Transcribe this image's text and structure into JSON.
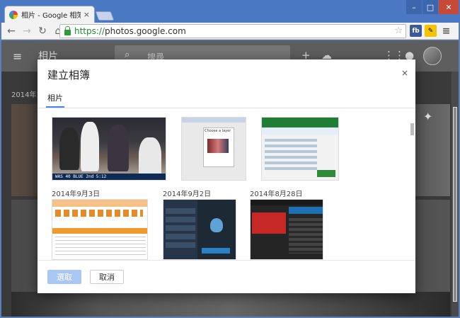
{
  "browser": {
    "tab_title": "相片 - Google 相簿",
    "tab_close": "×",
    "url_scheme": "https://",
    "url_host": "photos.google.com",
    "toolbar_icons": [
      "back-icon",
      "forward-icon",
      "reload-icon",
      "home-icon"
    ],
    "extensions": [
      {
        "name": "facebook-extension-icon",
        "label": "fb"
      },
      {
        "name": "evernote-extension-icon",
        "label": "✎"
      }
    ]
  },
  "app": {
    "title": "相片",
    "search_placeholder": "搜尋",
    "bg_date": "2014年1"
  },
  "dialog": {
    "title": "建立相簿",
    "close": "×",
    "tab": "相片",
    "groups": [
      {
        "date": ""
      },
      {
        "date": ""
      },
      {
        "date": ""
      },
      {
        "date": "2014年9月3日"
      },
      {
        "date": "2014年9月2日"
      },
      {
        "date": "2014年8月28日"
      }
    ],
    "thumb_text": {
      "scorebar": "WAS 40  BLUE 2nd 5:12",
      "window_label": "Choose a layer"
    },
    "primary_button": "選取",
    "cancel_button": "取消"
  },
  "colors": {
    "accent": "#4285f4",
    "primary_disabled": "#a9c7f5",
    "url_green": "#1e8a33"
  }
}
